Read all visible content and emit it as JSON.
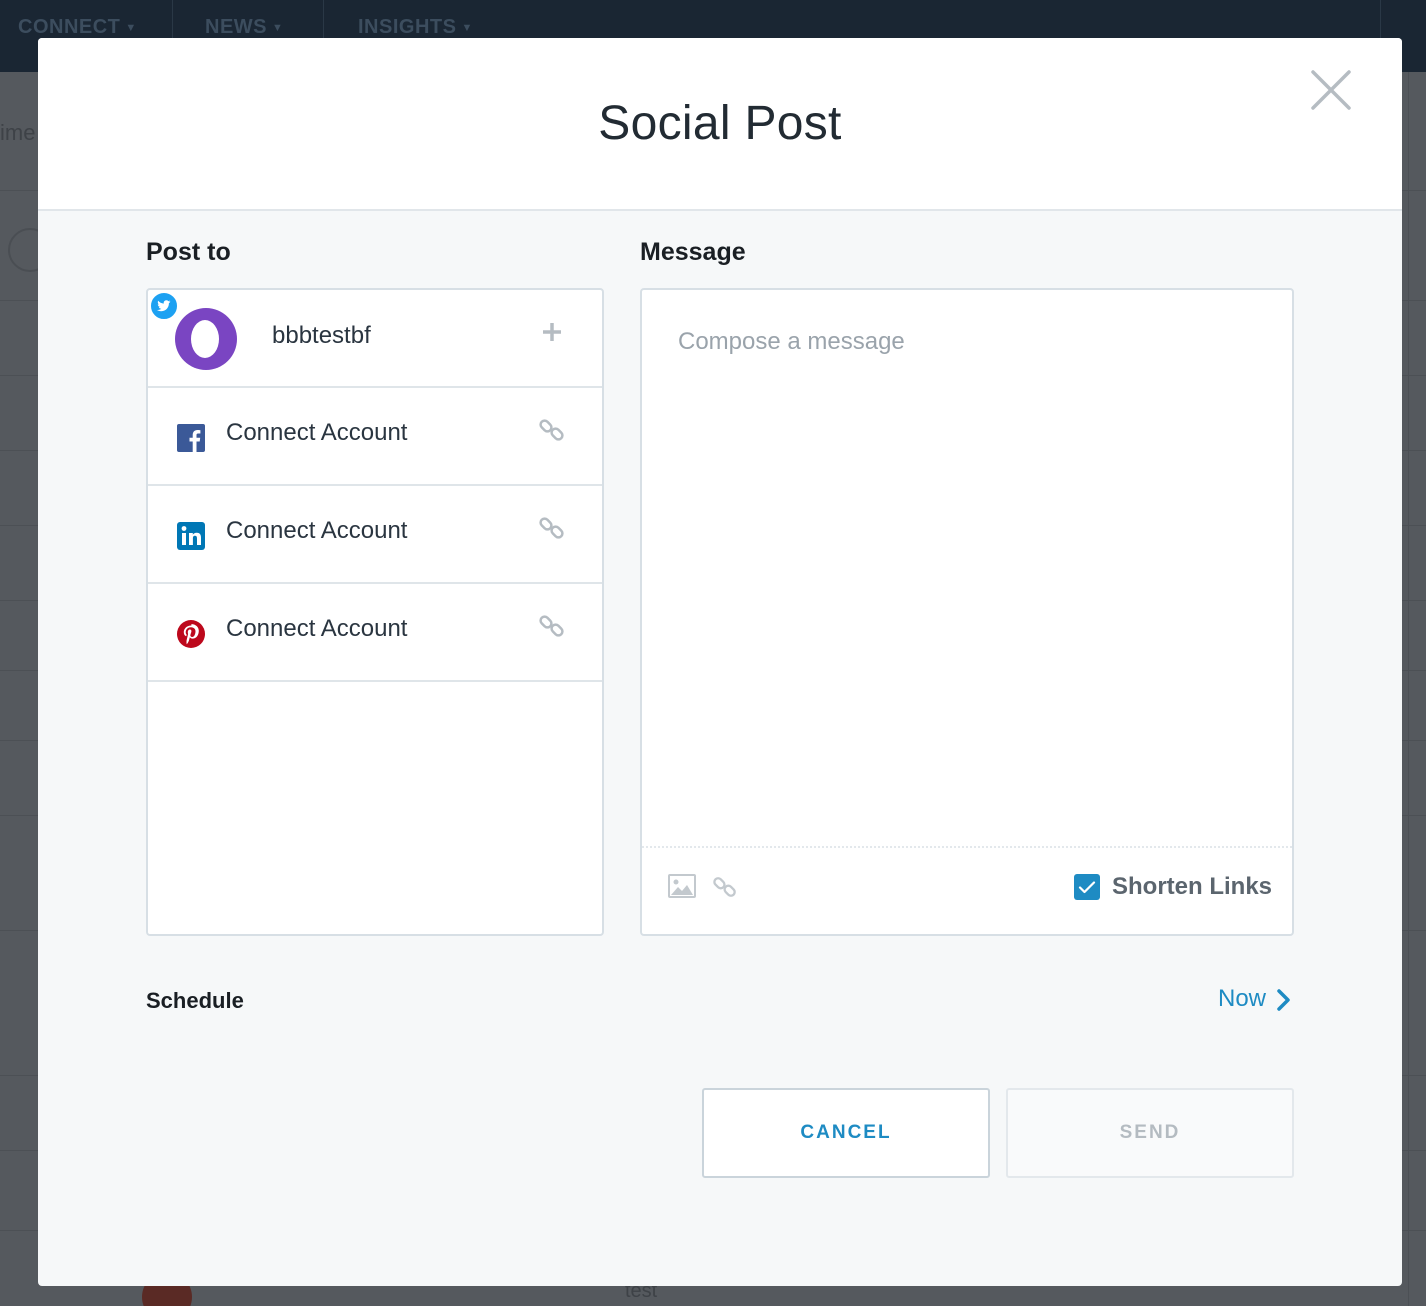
{
  "background": {
    "nav": [
      {
        "label": "CONNECT"
      },
      {
        "label": "NEWS"
      },
      {
        "label": "INSIGHTS"
      }
    ],
    "fragments": [
      "ime",
      "test"
    ]
  },
  "modal": {
    "title": "Social Post",
    "close_icon": "close-icon"
  },
  "post_to": {
    "label": "Post to",
    "accounts": [
      {
        "network": "twitter",
        "name": "bbbtestbf",
        "action_icon": "plus-icon",
        "brand_color": "#1da1f2",
        "avatar_color": "#7a45c2"
      },
      {
        "network": "facebook",
        "name": "Connect Account",
        "action_icon": "link-icon",
        "brand_color": "#3b5998"
      },
      {
        "network": "linkedin",
        "name": "Connect Account",
        "action_icon": "link-icon",
        "brand_color": "#0077b5"
      },
      {
        "network": "pinterest",
        "name": "Connect Account",
        "action_icon": "link-icon",
        "brand_color": "#bd081c"
      }
    ]
  },
  "message": {
    "label": "Message",
    "placeholder": "Compose a message",
    "value": "",
    "toolbar": {
      "image_icon": "image-icon",
      "link_icon": "link-icon",
      "shorten_links_label": "Shorten Links",
      "shorten_links_checked": true
    }
  },
  "schedule": {
    "label": "Schedule",
    "value": "Now"
  },
  "buttons": {
    "cancel": "CANCEL",
    "send": "SEND"
  },
  "colors": {
    "accent": "#1e8bc3",
    "modal_bg": "#f6f8f9",
    "header_bg": "#ffffff"
  }
}
